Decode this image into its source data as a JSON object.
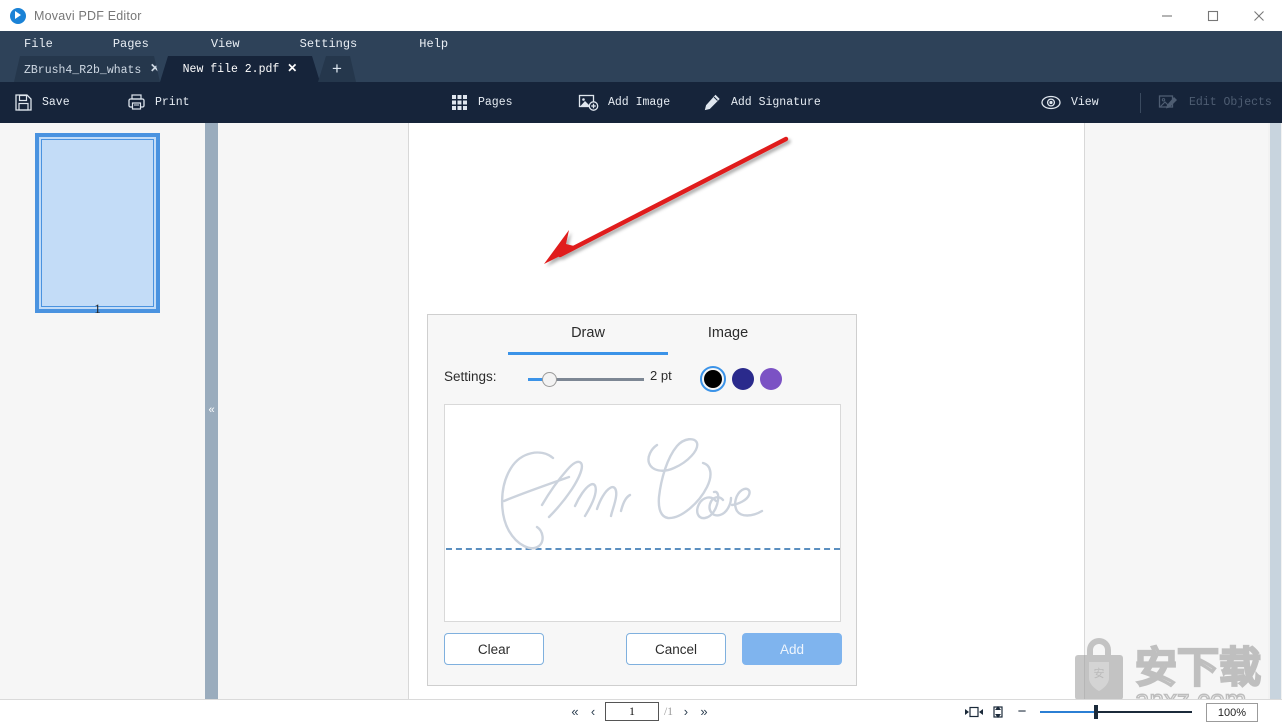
{
  "window": {
    "title": "Movavi PDF Editor",
    "minimize_label": "minimize",
    "maximize_label": "maximize",
    "close_label": "close"
  },
  "menu": {
    "items": [
      {
        "label": "File"
      },
      {
        "label": "Pages"
      },
      {
        "label": "View"
      },
      {
        "label": "Settings"
      },
      {
        "label": "Help"
      }
    ]
  },
  "tabs": {
    "items": [
      {
        "label": "ZBrush4_R2b_whats⋯",
        "close": "✕",
        "active": false
      },
      {
        "label": "New file 2.pdf",
        "close": "✕",
        "active": true
      }
    ],
    "new_tab_label": "+"
  },
  "toolbar": {
    "save_label": "Save",
    "print_label": "Print",
    "pages_label": "Pages",
    "add_image_label": "Add Image",
    "add_signature_label": "Add Signature",
    "view_label": "View",
    "edit_objects_label": "Edit Objects"
  },
  "thumbnails": {
    "pages": [
      {
        "number": "1",
        "selected": true
      }
    ],
    "collapse_label": "«"
  },
  "signature_dialog": {
    "tabs": [
      {
        "label": "Draw",
        "active": true
      },
      {
        "label": "Image",
        "active": false
      }
    ],
    "settings_label": "Settings:",
    "thickness_value": "2 pt",
    "thickness_slider_percent": 19,
    "colors": [
      {
        "name": "black",
        "hex": "#000000",
        "selected": true
      },
      {
        "name": "indigo",
        "hex": "#2a2a8c",
        "selected": false
      },
      {
        "name": "purple",
        "hex": "#7b52c4",
        "selected": false
      }
    ],
    "canvas_placeholder": "John Doe",
    "buttons": {
      "clear_label": "Clear",
      "cancel_label": "Cancel",
      "add_label": "Add"
    }
  },
  "status_bar": {
    "first_page_label": "«",
    "prev_page_label": "‹",
    "current_page": "1",
    "total_pages": "/1",
    "next_page_label": "›",
    "last_page_label": "»",
    "zoom_value": "100%",
    "zoom_out_label": "−",
    "zoom_in_label": "+",
    "fit_width_label": "fit-width",
    "fit_page_label": "fit-page"
  },
  "watermark": {
    "text_cn": "安下载",
    "text_en": "anxz.com",
    "badge_char": "安"
  },
  "colors": {
    "accent": "#3b93e8",
    "menubar_bg": "#2e4259",
    "toolbar_bg": "#16243a",
    "tab_active_bg": "#16243a",
    "annotation_red": "#e01b1b",
    "thumb_border": "#4a93e0"
  }
}
